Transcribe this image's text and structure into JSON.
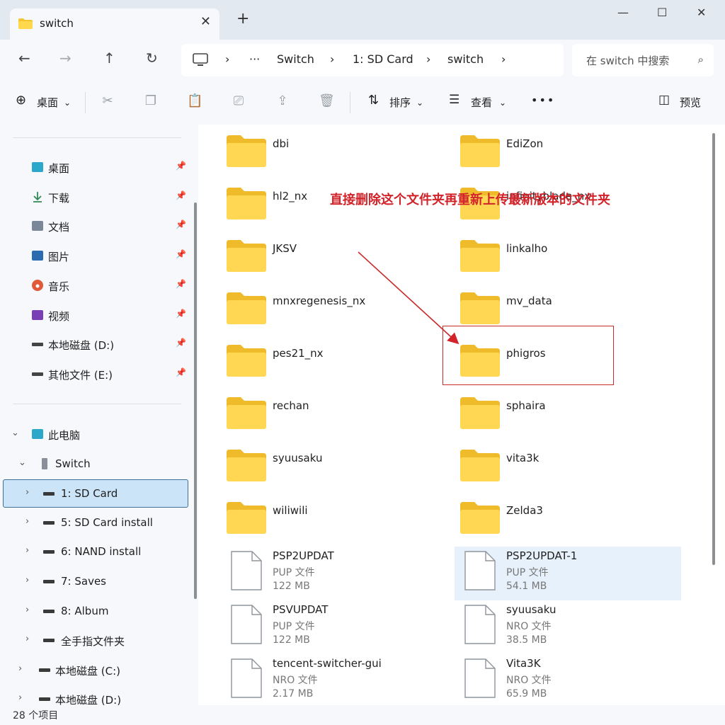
{
  "window": {
    "tab_title": "switch",
    "close_tab": "✕",
    "new_tab": "+",
    "minimize": "—",
    "maximize": "☐",
    "close": "✕"
  },
  "address": {
    "back": "←",
    "forward": "→",
    "up": "↑",
    "refresh": "↻",
    "crumbs": [
      "Switch",
      "1: SD Card",
      "switch"
    ],
    "separator": "›",
    "ellipsis": "···",
    "search_placeholder": "在 switch 中搜索",
    "search_icon": "⌕"
  },
  "toolbar": {
    "new_label": "桌面",
    "sort_label": "排序",
    "view_label": "查看",
    "more": "•••",
    "details_label": "预览"
  },
  "sidebar": {
    "quick": [
      {
        "label": "桌面",
        "icon": "desktop-icon",
        "color": "#2aa7c9"
      },
      {
        "label": "下载",
        "icon": "download-icon",
        "color": "#2e8b57"
      },
      {
        "label": "文档",
        "icon": "document-icon",
        "color": "#7a8799"
      },
      {
        "label": "图片",
        "icon": "pictures-icon",
        "color": "#2b6cb0"
      },
      {
        "label": "音乐",
        "icon": "music-icon",
        "color": "#e05a3a"
      },
      {
        "label": "视频",
        "icon": "video-icon",
        "color": "#7b3fb5"
      },
      {
        "label": "本地磁盘 (D:)",
        "icon": "drive-icon",
        "color": "#444444"
      },
      {
        "label": "其他文件 (E:)",
        "icon": "drive-icon",
        "color": "#444444"
      }
    ],
    "pin": "📌",
    "tree": [
      {
        "label": "此电脑",
        "level": 0,
        "chevron": "⌄"
      },
      {
        "label": "Switch",
        "level": 1,
        "chevron": "⌄"
      },
      {
        "label": "1: SD Card",
        "level": 2,
        "chevron": "›",
        "selected": true
      },
      {
        "label": "5: SD Card install",
        "level": 2,
        "chevron": "›"
      },
      {
        "label": "6: NAND install",
        "level": 2,
        "chevron": "›"
      },
      {
        "label": "7: Saves",
        "level": 2,
        "chevron": "›"
      },
      {
        "label": "8: Album",
        "level": 2,
        "chevron": "›"
      },
      {
        "label": "全手指文件夹",
        "level": 2,
        "chevron": "›"
      },
      {
        "label": "本地磁盘 (C:)",
        "level": 1,
        "chevron": "›"
      },
      {
        "label": "本地磁盘 (D:)",
        "level": 1,
        "chevron": "›"
      }
    ]
  },
  "content": {
    "folders_left": [
      "dbi",
      "hl2_nx",
      "JKSV",
      "mnxregenesis_nx",
      "pes21_nx",
      "rechan",
      "syuusaku",
      "wiliwili"
    ],
    "folders_right": [
      "EdiZon",
      "infinityblade_nx",
      "linkalho",
      "mv_data",
      "phigros",
      "sphaira",
      "vita3k",
      "Zelda3"
    ],
    "files_left": [
      {
        "name": "PSP2UPDAT",
        "type": "PUP 文件",
        "size": "122 MB"
      },
      {
        "name": "PSVUPDAT",
        "type": "PUP 文件",
        "size": "122 MB"
      },
      {
        "name": "tencent-switcher-gui",
        "type": "NRO 文件",
        "size": "2.17 MB"
      }
    ],
    "files_right": [
      {
        "name": "PSP2UPDAT-1",
        "type": "PUP 文件",
        "size": "54.1 MB"
      },
      {
        "name": "syuusaku",
        "type": "NRO 文件",
        "size": "38.5 MB"
      },
      {
        "name": "Vita3K",
        "type": "NRO 文件",
        "size": "65.9 MB"
      }
    ],
    "annotation": "直接删除这个文件夹再重新上传最新版本的文件夹",
    "annotation_color": "#d2232a"
  },
  "status": {
    "count": "28 个项目"
  }
}
